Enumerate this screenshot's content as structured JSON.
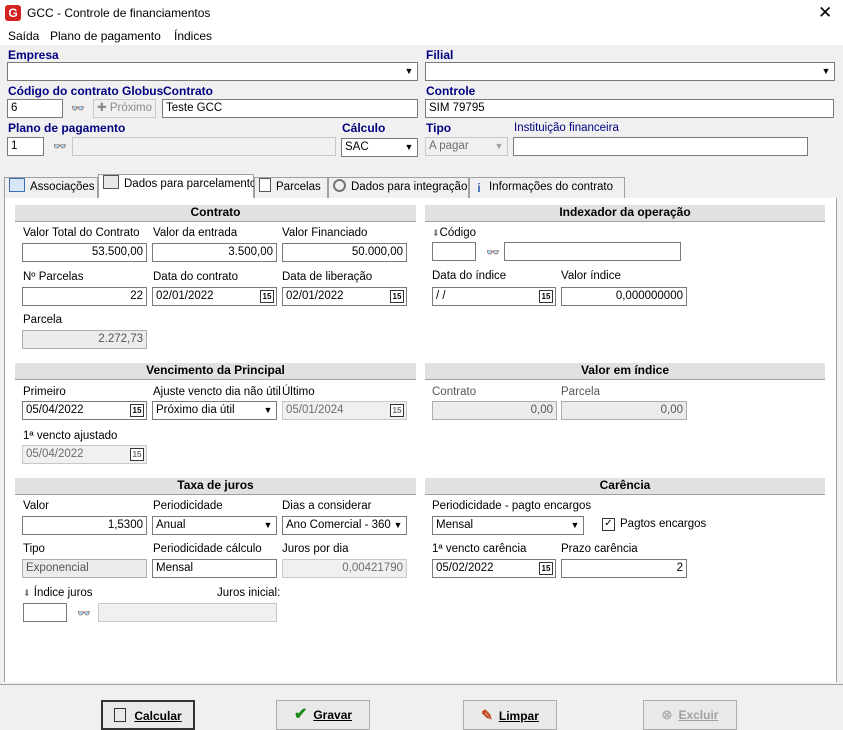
{
  "window": {
    "app_icon": "G",
    "title": "GCC - Controle de financiamentos",
    "close_glyph": "✕"
  },
  "menu": [
    "Saída",
    "Plano de pagamento",
    "Índices"
  ],
  "top": {
    "empresa_label": "Empresa",
    "empresa_value": "",
    "filial_label": "Filial",
    "filial_value": "",
    "codigo_label": "Código do contrato Globus",
    "codigo_value": "6",
    "proximo_label": "Próximo",
    "contrato_label": "Contrato",
    "contrato_value": "Teste GCC",
    "controle_label": "Controle",
    "controle_value": "SIM 79795",
    "plano_label": "Plano de pagamento",
    "plano_value": "1",
    "plano_desc": "",
    "calculo_label": "Cálculo",
    "calculo_value": "SAC",
    "tipo_label": "Tipo",
    "tipo_value": "A pagar",
    "instituicao_label": "Instituição financeira",
    "instituicao_value": ""
  },
  "tabs": [
    {
      "label": "Associações",
      "icon": "building-icon"
    },
    {
      "label": "Dados para parcelamento",
      "icon": "calculator-icon"
    },
    {
      "label": "Parcelas",
      "icon": "document-icon"
    },
    {
      "label": "Dados para integração",
      "icon": "gear-icon"
    },
    {
      "label": "Informações do contrato",
      "icon": "info-icon"
    }
  ],
  "contrato": {
    "header": "Contrato",
    "valor_total_label": "Valor Total do Contrato",
    "valor_total": "53.500,00",
    "valor_entrada_label": "Valor da entrada",
    "valor_entrada": "3.500,00",
    "valor_financiado_label": "Valor Financiado",
    "valor_financiado": "50.000,00",
    "nparcelas_label": "Nº Parcelas",
    "nparcelas": "22",
    "data_contrato_label": "Data do contrato",
    "data_contrato": "02/01/2022",
    "data_liberacao_label": "Data de liberação",
    "data_liberacao": "02/01/2022",
    "parcela_label": "Parcela",
    "parcela": "2.272,73"
  },
  "indexador": {
    "header": "Indexador da operação",
    "codigo_label": "Código",
    "codigo": "",
    "descricao": "",
    "data_indice_label": "Data do índice",
    "data_indice": " /  /",
    "valor_indice_label": "Valor índice",
    "valor_indice": "0,000000000"
  },
  "vencimento": {
    "header": "Vencimento da Principal",
    "primeiro_label": "Primeiro",
    "primeiro": "05/04/2022",
    "ajuste_label": "Ajuste vencto dia não útil",
    "ajuste": "Próximo dia útil",
    "ultimo_label": "Último",
    "ultimo": "05/01/2024",
    "ajustado_label": "1ª vencto ajustado",
    "ajustado": "05/04/2022"
  },
  "valor_indice": {
    "header": "Valor em índice",
    "contrato_label": "Contrato",
    "contrato": "0,00",
    "parcela_label": "Parcela",
    "parcela": "0,00"
  },
  "juros": {
    "header": "Taxa de juros",
    "valor_label": "Valor",
    "valor": "1,5300",
    "periodicidade_label": "Periodicidade",
    "periodicidade": "Anual",
    "dias_label": "Dias a considerar",
    "dias": "Ano Comercial - 360",
    "tipo_label": "Tipo",
    "tipo": "Exponencial",
    "period_calc_label": "Periodicidade cálculo",
    "period_calc": "Mensal",
    "juros_dia_label": "Juros por dia",
    "juros_dia": "0,00421790",
    "indice_juros_label": "Índice juros",
    "indice_juros": "",
    "juros_inicial_label": "Juros inicial:",
    "juros_inicial": ""
  },
  "carencia": {
    "header": "Carência",
    "period_label": "Periodicidade - pagto encargos",
    "period": "Mensal",
    "pagtos_label": "Pagtos encargos",
    "pagtos_checked": "✓",
    "vencto_label": "1ª vencto carência",
    "vencto": "05/02/2022",
    "prazo_label": "Prazo carência",
    "prazo": "2"
  },
  "buttons": {
    "calcular": "Calcular",
    "gravar": "Gravar",
    "limpar": "Limpar",
    "excluir": "Excluir"
  },
  "glyphs": {
    "dropdown": "▼",
    "calendar": "15",
    "binoculars": "👓",
    "pin": "⬇"
  }
}
